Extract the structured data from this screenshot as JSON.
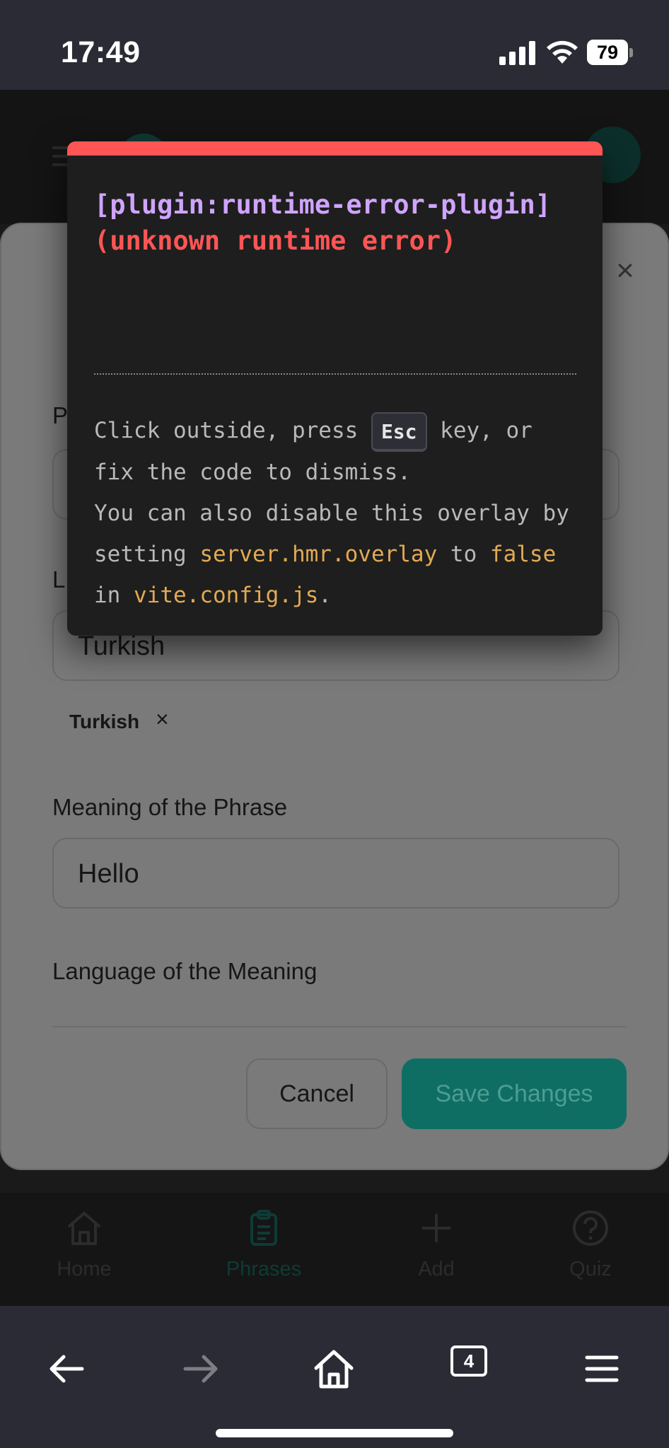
{
  "status_bar": {
    "time": "17:49",
    "battery_level": "79",
    "icons": [
      "cellular-signal-icon",
      "wifi-icon",
      "battery-icon"
    ]
  },
  "modal": {
    "fields": {
      "phrase_label": "P",
      "language_label": "L",
      "language_value": "Turkish",
      "language_chip": "Turkish",
      "chip_remove": "×",
      "meaning_label": "Meaning of the Phrase",
      "meaning_value": "Hello",
      "meaning_language_label": "Language of the Meaning"
    },
    "close_glyph": "×",
    "buttons": {
      "cancel": "Cancel",
      "save": "Save Changes"
    }
  },
  "bottom_nav": {
    "items": [
      {
        "label": "Home",
        "icon": "home-icon"
      },
      {
        "label": "Phrases",
        "icon": "clipboard-icon",
        "active": true
      },
      {
        "label": "Add",
        "icon": "plus-icon"
      },
      {
        "label": "Quiz",
        "icon": "question-icon"
      }
    ]
  },
  "error_overlay": {
    "plugin": "[plugin:runtime-error-plugin]",
    "message": "(unknown runtime error)",
    "tip": {
      "line1_a": "Click outside, press ",
      "key": "Esc",
      "line1_b": " key, or fix the code to dismiss.",
      "line2_a": "You can also disable this overlay by setting ",
      "code_setting": "server.hmr.overlay",
      "line2_b": " to ",
      "code_false": "false",
      "line2_c": " in ",
      "code_file": "vite.config.js",
      "line2_d": "."
    },
    "colors": {
      "accent_bar": "#ff5555",
      "plugin": "#cfa4ff",
      "code": "#e2aa53"
    }
  },
  "browser_toolbar": {
    "tab_count": "4",
    "buttons": [
      "back-arrow-icon",
      "forward-arrow-icon",
      "home-icon",
      "tabs-icon",
      "menu-icon"
    ]
  }
}
